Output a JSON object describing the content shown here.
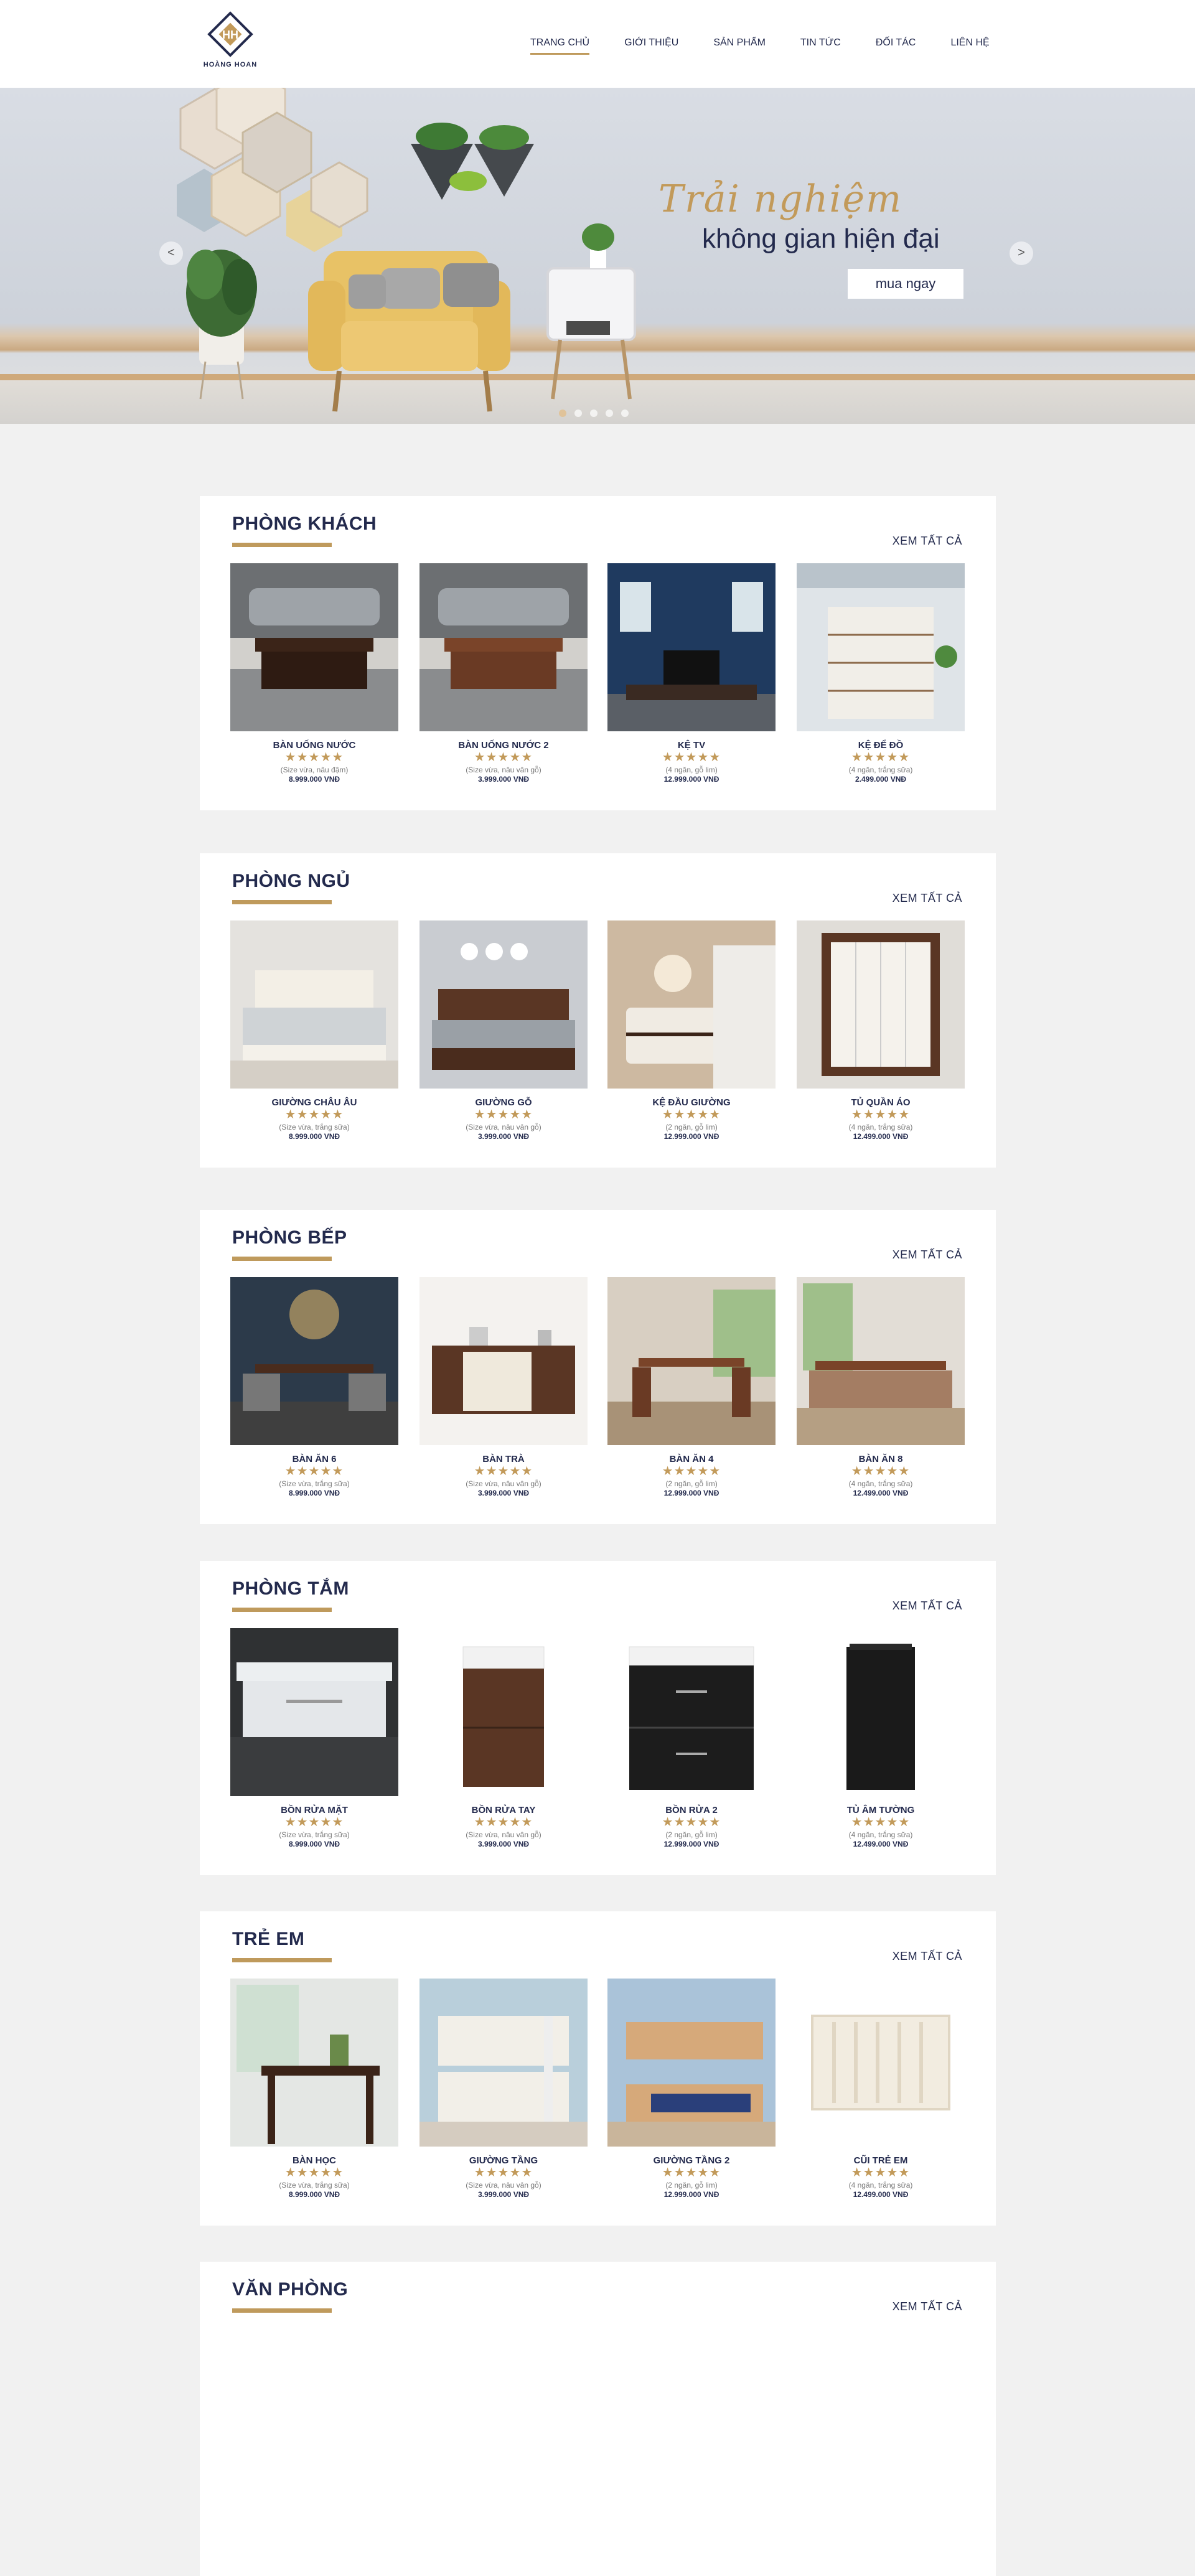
{
  "brand": {
    "name": "HOÀNG HOAN",
    "monogram": "HH"
  },
  "nav": [
    {
      "label": "TRANG CHỦ",
      "active": true
    },
    {
      "label": "GIỚI THIỆU"
    },
    {
      "label": "SẢN PHẨM"
    },
    {
      "label": "TIN TỨC"
    },
    {
      "label": "ĐỐI TÁC"
    },
    {
      "label": "LIÊN HỆ"
    }
  ],
  "hero": {
    "script": "Trải nghiệm",
    "title": "không gian hiện đại",
    "button": "mua ngay",
    "prev": "<",
    "next": ">",
    "slide_count": 5,
    "active_slide": 1
  },
  "colors": {
    "accent": "#bf9a5c",
    "navy": "#232a4d",
    "background": "#f1f1f1"
  },
  "sections": [
    {
      "title": "PHÒNG KHÁCH",
      "more": "XEM TẤT CẢ",
      "products": [
        {
          "name": "BÀN UỐNG NƯỚC",
          "stars": "★★★★★",
          "desc": "(Size vừa, nâu đậm)",
          "price": "8.999.000 VNĐ",
          "img": "coffee-table-dark"
        },
        {
          "name": "BÀN UỐNG NƯỚC 2",
          "stars": "★★★★★",
          "desc": "(Size vừa, nâu vân gỗ)",
          "price": "3.999.000 VNĐ",
          "img": "coffee-table-wood"
        },
        {
          "name": "KỆ TV",
          "stars": "★★★★★",
          "desc": "(4 ngăn, gỗ lim)",
          "price": "12.999.000 VNĐ",
          "img": "tv-stand"
        },
        {
          "name": "KỆ ĐỂ ĐỒ",
          "stars": "★★★★★",
          "desc": "(4 ngăn, trắng sữa)",
          "price": "2.499.000 VNĐ",
          "img": "dresser-white"
        }
      ]
    },
    {
      "title": "PHÒNG NGỦ",
      "more": "XEM TẤT CẢ",
      "products": [
        {
          "name": "GIƯỜNG CHÂU ÂU",
          "stars": "★★★★★",
          "desc": "(Size vừa, trắng sữa)",
          "price": "8.999.000 VNĐ",
          "img": "bed-white"
        },
        {
          "name": "GIƯỜNG GỖ",
          "stars": "★★★★★",
          "desc": "(Size vừa, nâu vân gỗ)",
          "price": "3.999.000 VNĐ",
          "img": "bed-wood"
        },
        {
          "name": "KỆ ĐẦU GIƯỜNG",
          "stars": "★★★★★",
          "desc": "(2 ngăn, gỗ lim)",
          "price": "12.999.000 VNĐ",
          "img": "nightstand"
        },
        {
          "name": "TỦ QUẦN ÁO",
          "stars": "★★★★★",
          "desc": "(4 ngăn, trắng sữa)",
          "price": "12.499.000 VNĐ",
          "img": "wardrobe"
        }
      ]
    },
    {
      "title": "PHÒNG BẾP",
      "more": "XEM TẤT CẢ",
      "products": [
        {
          "name": "BÀN ĂN 6",
          "stars": "★★★★★",
          "desc": "(Size vừa, trắng sữa)",
          "price": "8.999.000 VNĐ",
          "img": "dining-6"
        },
        {
          "name": "BÀN TRÀ",
          "stars": "★★★★★",
          "desc": "(Size vừa, nâu vân gỗ)",
          "price": "3.999.000 VNĐ",
          "img": "sideboard"
        },
        {
          "name": "BÀN ĂN 4",
          "stars": "★★★★★",
          "desc": "(2 ngăn, gỗ lim)",
          "price": "12.999.000 VNĐ",
          "img": "dining-4"
        },
        {
          "name": "BÀN ĂN 8",
          "stars": "★★★★★",
          "desc": "(4 ngăn, trắng sữa)",
          "price": "12.499.000 VNĐ",
          "img": "dining-8"
        }
      ]
    },
    {
      "title": "PHÒNG TẮM",
      "more": "XEM TẤT CẢ",
      "products": [
        {
          "name": "BỒN RỬA MẶT",
          "stars": "★★★★★",
          "desc": "(Size vừa, trắng sữa)",
          "price": "8.999.000 VNĐ",
          "img": "vanity-white"
        },
        {
          "name": "BỒN RỬA TAY",
          "stars": "★★★★★",
          "desc": "(Size vừa, nâu vân gỗ)",
          "price": "3.999.000 VNĐ",
          "img": "vanity-wood"
        },
        {
          "name": "BỒN RỬA 2",
          "stars": "★★★★★",
          "desc": "(2 ngăn, gỗ lim)",
          "price": "12.999.000 VNĐ",
          "img": "vanity-black"
        },
        {
          "name": "TỦ ÂM TƯỜNG",
          "stars": "★★★★★",
          "desc": "(4 ngăn, trắng sữa)",
          "price": "12.499.000 VNĐ",
          "img": "cabinet-black"
        }
      ]
    },
    {
      "title": "TRẺ EM",
      "more": "XEM TẤT CẢ",
      "products": [
        {
          "name": "BÀN HỌC",
          "stars": "★★★★★",
          "desc": "(Size vừa, trắng sữa)",
          "price": "8.999.000 VNĐ",
          "img": "desk"
        },
        {
          "name": "GIƯỜNG TẦNG",
          "stars": "★★★★★",
          "desc": "(Size vừa, nâu vân gỗ)",
          "price": "3.999.000 VNĐ",
          "img": "bunk-white"
        },
        {
          "name": "GIƯỜNG TẦNG 2",
          "stars": "★★★★★",
          "desc": "(2 ngăn, gỗ lim)",
          "price": "12.999.000 VNĐ",
          "img": "bunk-wood"
        },
        {
          "name": "CŨI TRẺ EM",
          "stars": "★★★★★",
          "desc": "(4 ngăn, trắng sữa)",
          "price": "12.499.000 VNĐ",
          "img": "crib"
        }
      ]
    },
    {
      "title": "VĂN PHÒNG",
      "more": "XEM TẤT CẢ",
      "products": []
    }
  ]
}
